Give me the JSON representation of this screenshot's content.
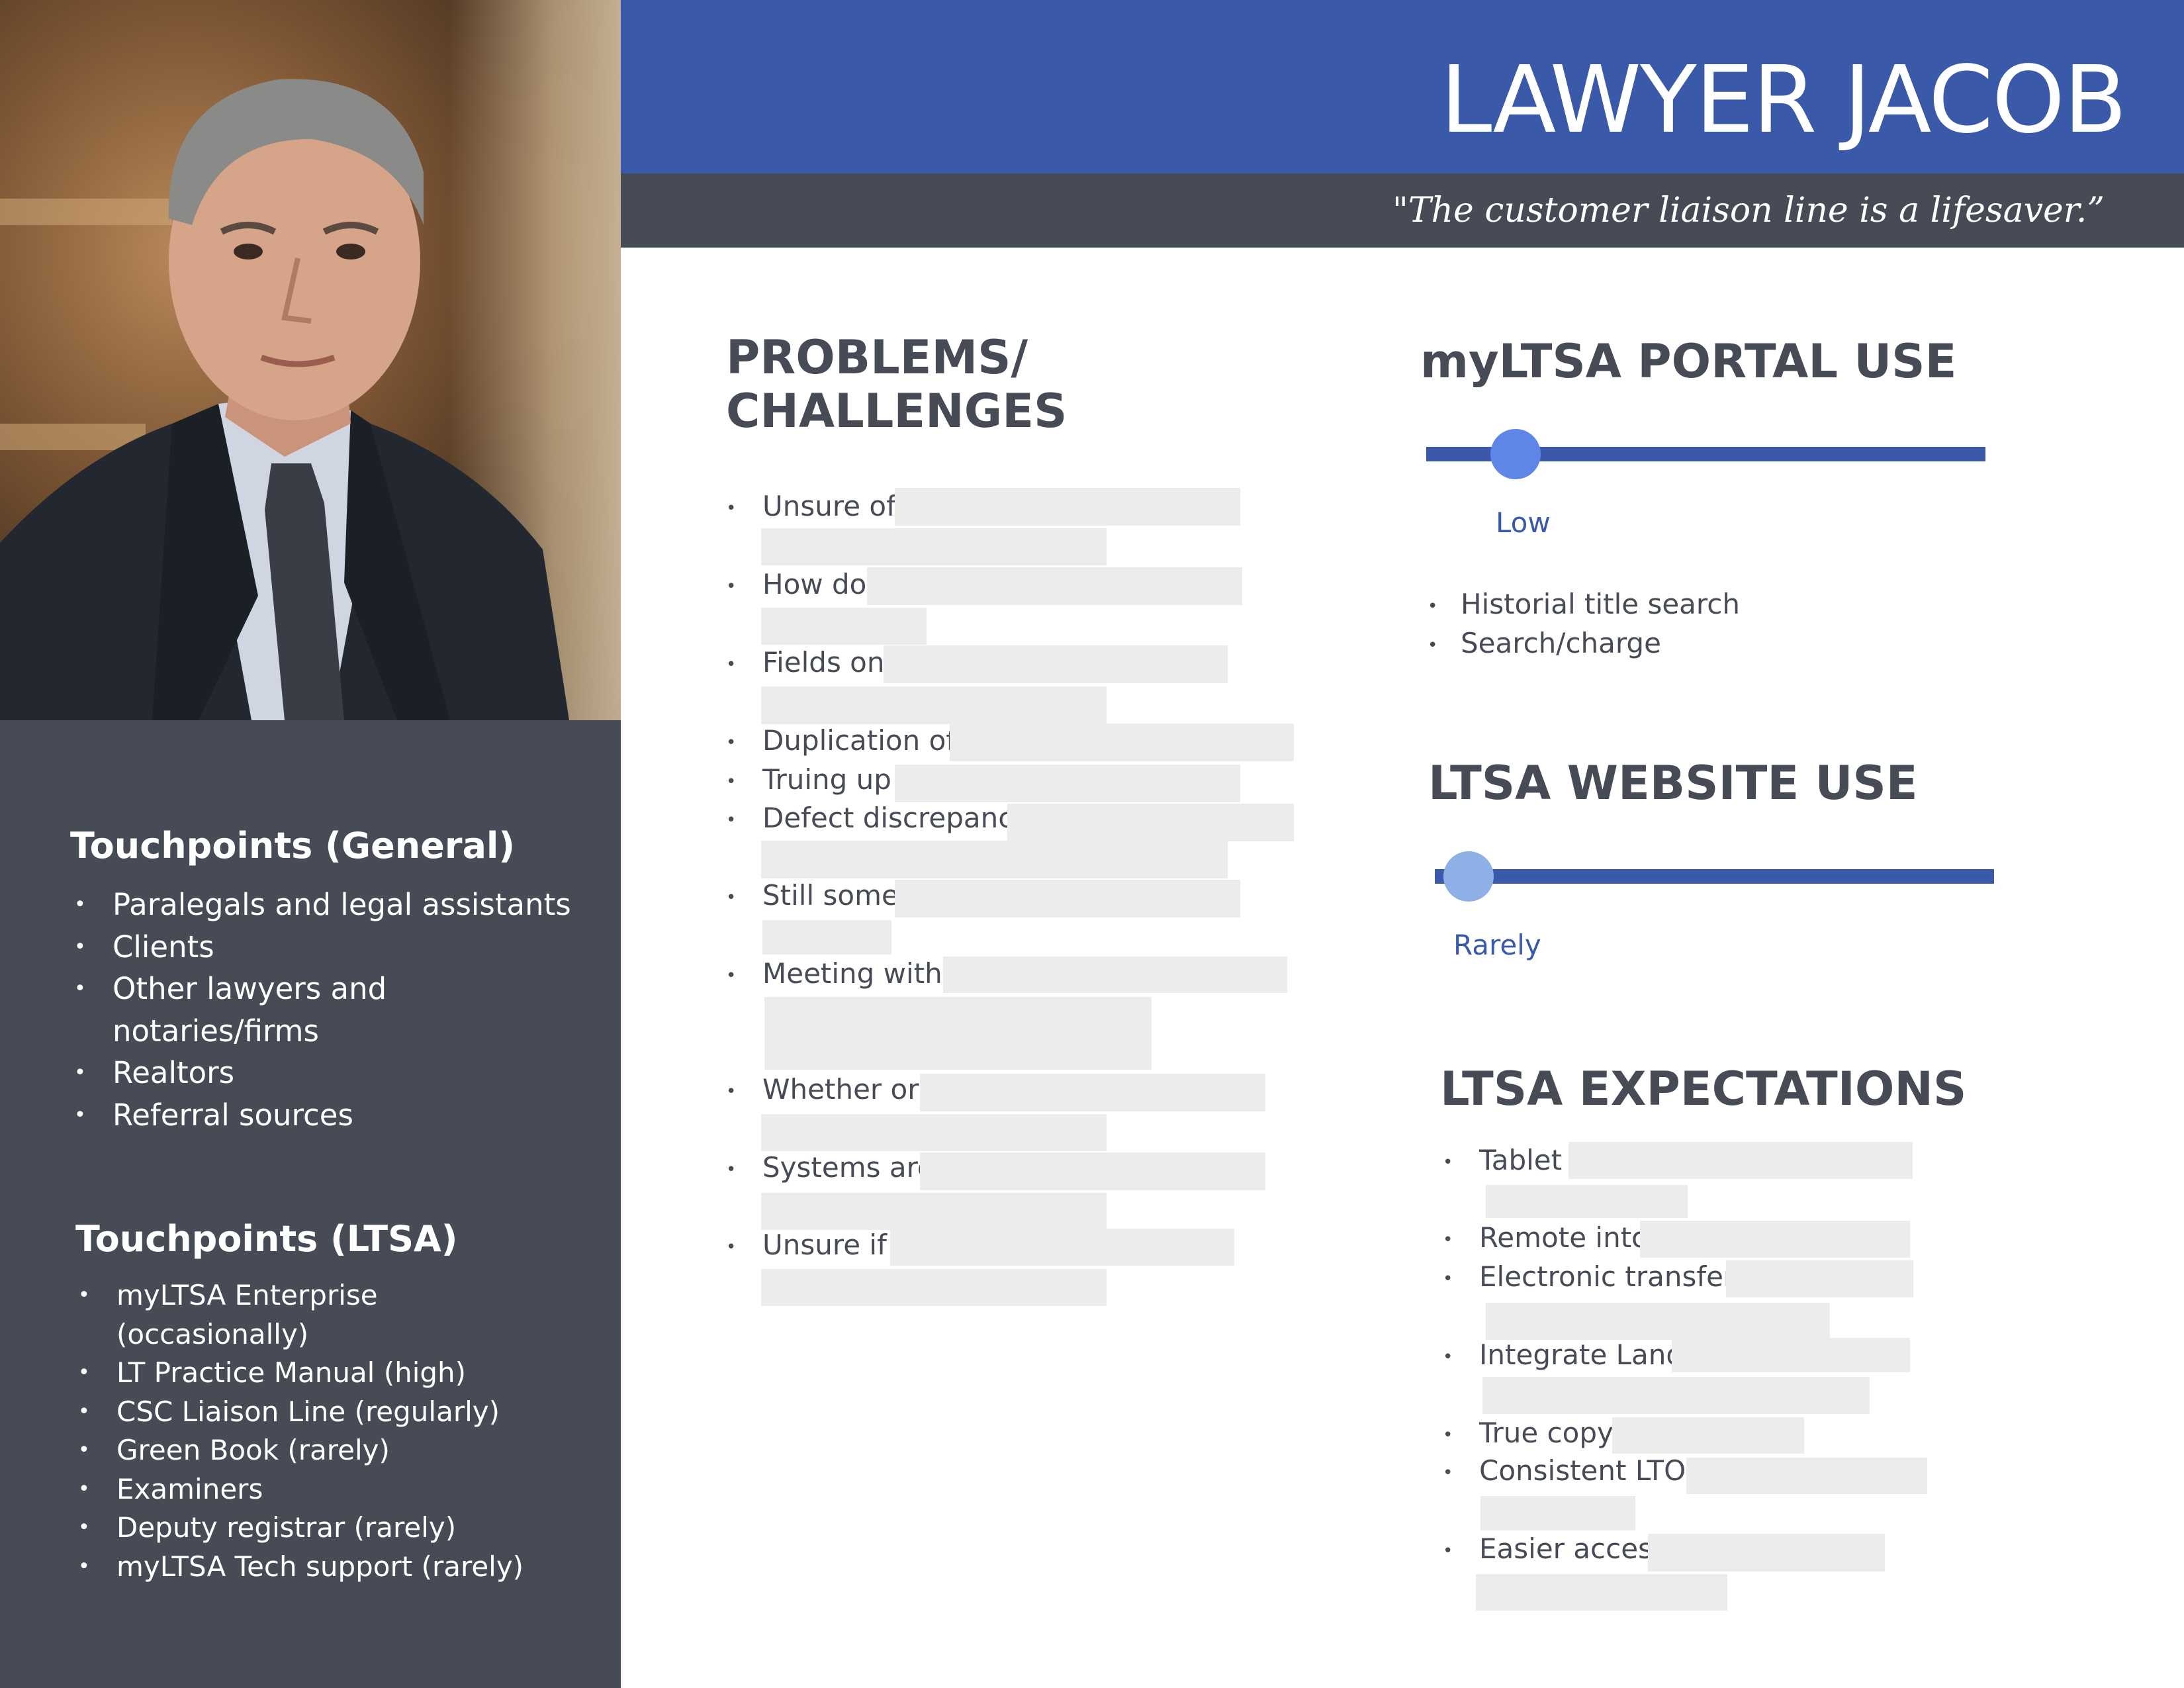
{
  "header": {
    "title": "LAWYER JACOB",
    "quote": "\"The customer liaison line is a lifesaver.”"
  },
  "sidebar": {
    "general_heading": "Touchpoints (General)",
    "general_items": [
      "Paralegals and legal assistants",
      "Clients",
      "Other lawyers and",
      "notaries/firms",
      "Realtors",
      "Referral sources"
    ],
    "ltsa_heading": "Touchpoints (LTSA)",
    "ltsa_items": [
      "myLTSA Enterprise",
      "(occasionally)",
      "LT Practice Manual (high)",
      "CSC Liaison Line (regularly)",
      "Green Book (rarely)",
      "Examiners",
      "Deputy registrar (rarely)",
      "myLTSA Tech support (rarely)"
    ]
  },
  "problems": {
    "heading_line1": "PROBLEMS/",
    "heading_line2": "CHALLENGES",
    "items": [
      "Unsure of",
      "How do",
      "Fields on",
      "Duplication of",
      "Truing up",
      "Defect discrepancy",
      "Still some",
      "Meeting with",
      "Whether or",
      "Systems are",
      "Unsure if"
    ]
  },
  "portal": {
    "heading": "myLTSA PORTAL USE",
    "level_label": "Low",
    "level_fraction": 0.16,
    "items": [
      "Historial title search",
      "Search/charge"
    ]
  },
  "website": {
    "heading": "LTSA WEBSITE USE",
    "level_label": "Rarely",
    "level_fraction": 0.06
  },
  "expectations": {
    "heading": "LTSA EXPECTATIONS",
    "items": [
      "Tablet",
      "Remote into",
      "Electronic transfer",
      "Integrate Land",
      "True copy",
      "Consistent LTO",
      "Easier access"
    ]
  },
  "colors": {
    "header_blue": "#3a59a8",
    "dark_slate": "#474b56",
    "knob_portal": "#5f86e6",
    "knob_website": "#8fb0e6",
    "redaction": "#ececec"
  }
}
